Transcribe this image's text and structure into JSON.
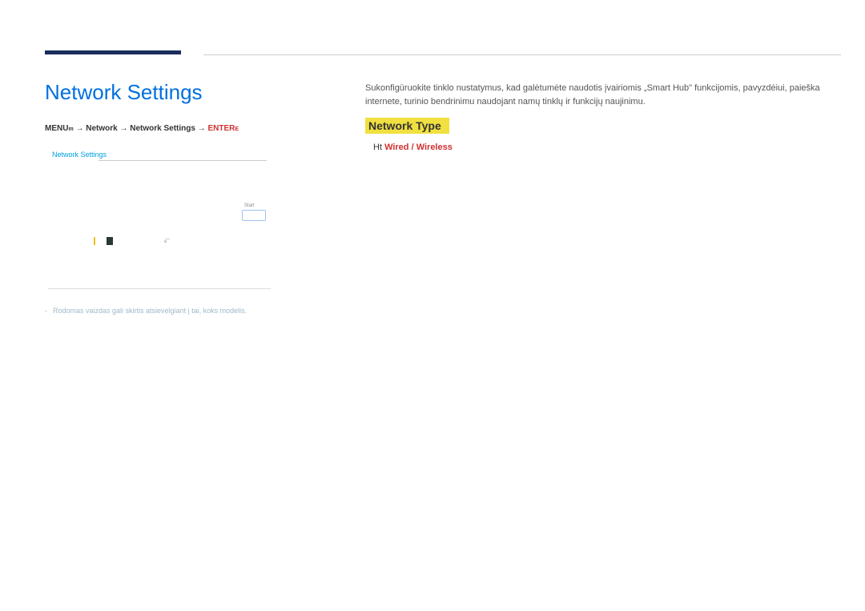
{
  "mainTitle": "Network Settings",
  "breadcrumb": {
    "menuPrefix": "MENU",
    "m": "m",
    "part1": " → Network → Network Settings → ",
    "enterPrefix": "ENTER",
    "e": "E"
  },
  "panel": {
    "label": "Network Settings",
    "startLabel": "Start"
  },
  "footnote": {
    "dash": "-",
    "text": "Rodomas vaizdas gali skirtis atsievelgiant į tai, koks modelis."
  },
  "bodyText": "Sukonfigūruokite tinklo nustatymus, kad galėtumėte naudotis įvairiomis „Smart Hub\" funkcijomis, pavyzdėiui, paieška internete, turinio bendrinimu naudojant namų tinklų ir funkcijų naujinimu.",
  "networkType": {
    "label": "Network Type",
    "lead": "Ht",
    "options": "Wired / Wireless"
  }
}
